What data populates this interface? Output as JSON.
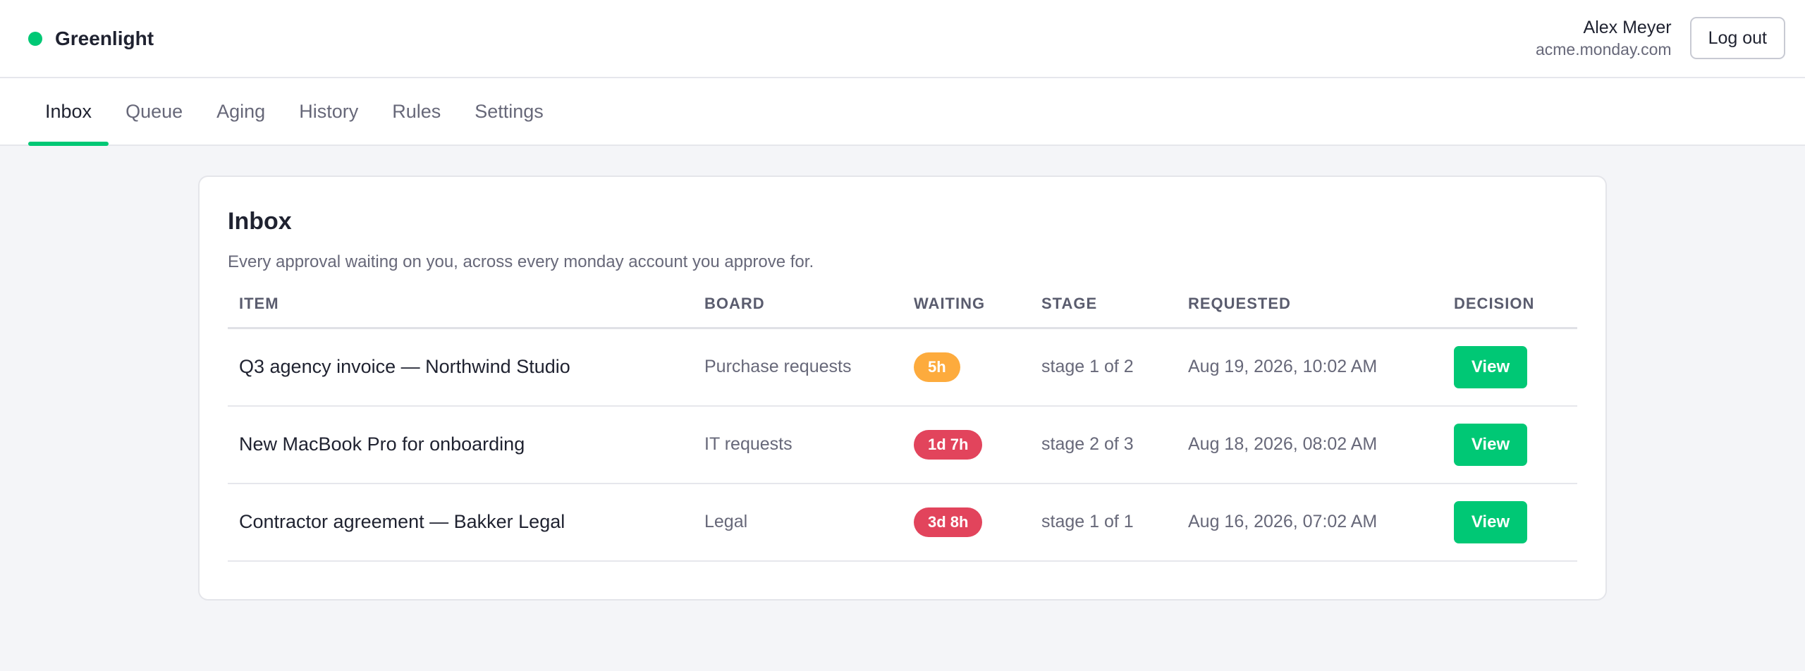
{
  "brand": {
    "name": "Greenlight",
    "dot_color": "#00c875"
  },
  "user": {
    "name": "Alex Meyer",
    "account": "acme.monday.com",
    "logout_label": "Log out"
  },
  "nav": {
    "tabs": [
      {
        "label": "Inbox",
        "active": true
      },
      {
        "label": "Queue",
        "active": false
      },
      {
        "label": "Aging",
        "active": false
      },
      {
        "label": "History",
        "active": false
      },
      {
        "label": "Rules",
        "active": false
      },
      {
        "label": "Settings",
        "active": false
      }
    ]
  },
  "inbox": {
    "title": "Inbox",
    "subtitle": "Every approval waiting on you, across every monday account you approve for.",
    "columns": [
      "ITEM",
      "BOARD",
      "WAITING",
      "STAGE",
      "REQUESTED",
      "DECISION"
    ],
    "rows": [
      {
        "item": "Q3 agency invoice — Northwind Studio",
        "board": "Purchase requests",
        "waiting": "5h",
        "waiting_color": "#fdab3d",
        "stage": "stage 1 of 2",
        "requested": "Aug 19, 2026, 10:02 AM",
        "action": "View"
      },
      {
        "item": "New MacBook Pro for onboarding",
        "board": "IT requests",
        "waiting": "1d 7h",
        "waiting_color": "#e2445c",
        "stage": "stage 2 of 3",
        "requested": "Aug 18, 2026, 08:02 AM",
        "action": "View"
      },
      {
        "item": "Contractor agreement — Bakker Legal",
        "board": "Legal",
        "waiting": "3d 8h",
        "waiting_color": "#e2445c",
        "stage": "stage 1 of 1",
        "requested": "Aug 16, 2026, 07:02 AM",
        "action": "View"
      }
    ]
  },
  "colors": {
    "accent": "#00c875",
    "warning": "#fdab3d",
    "danger": "#e2445c"
  }
}
